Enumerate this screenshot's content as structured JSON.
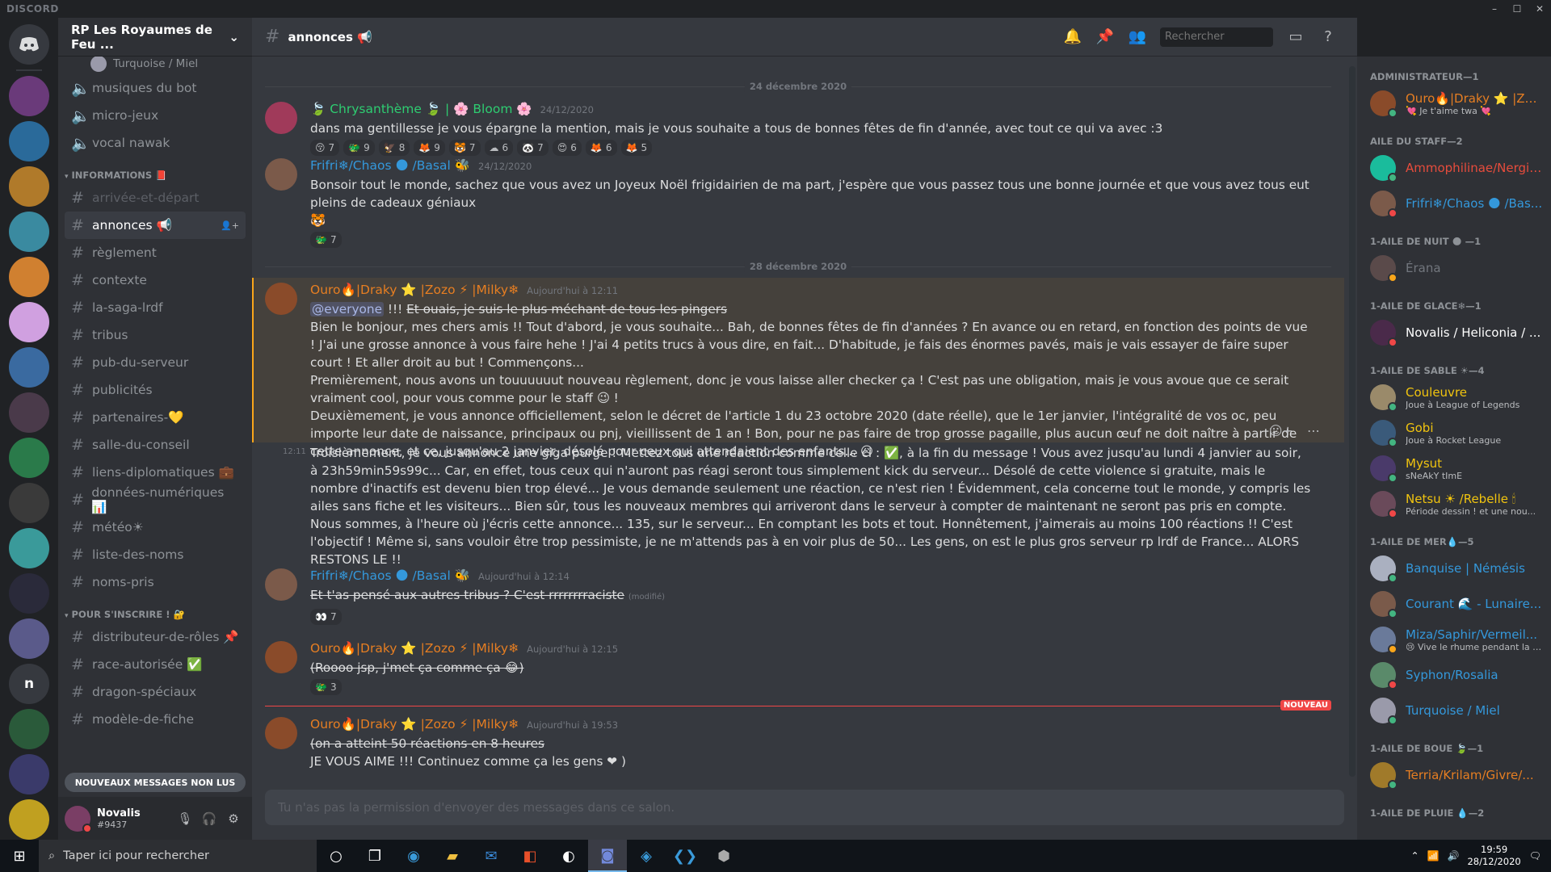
{
  "titlebar": {
    "brand": "DISCORD"
  },
  "guild": {
    "name": "RP Les Royaumes de Feu ..."
  },
  "channels": {
    "partial_top": "Turquoise / Miel",
    "voice": [
      "musiques du bot",
      "micro-jeux",
      "vocal nawak"
    ],
    "category_info": "INFORMATIONS 📕",
    "info_list": [
      {
        "name": "arrivée-et-départ",
        "faded": true
      },
      {
        "name": "annonces 📢",
        "selected": true
      },
      {
        "name": "règlement"
      },
      {
        "name": "contexte"
      },
      {
        "name": "la-saga-lrdf"
      },
      {
        "name": "tribus"
      },
      {
        "name": "pub-du-serveur"
      },
      {
        "name": "publicités"
      },
      {
        "name": "partenaires-💛"
      },
      {
        "name": "salle-du-conseil"
      },
      {
        "name": "liens-diplomatiques 💼"
      },
      {
        "name": "données-numériques 📊"
      },
      {
        "name": "météo☀"
      },
      {
        "name": "liste-des-noms"
      },
      {
        "name": "noms-pris"
      }
    ],
    "category_signup": "POUR S'INSCRIRE ! 🔐",
    "signup_list": [
      {
        "name": "distributeur-de-rôles 📌"
      },
      {
        "name": "race-autorisée ✅"
      },
      {
        "name": "dragon-spéciaux"
      },
      {
        "name": "modèle-de-fiche"
      }
    ],
    "new_messages_btn": "NOUVEAUX MESSAGES NON LUS"
  },
  "user": {
    "name": "Novalis",
    "tag": "#9437"
  },
  "chat": {
    "channel_title": "annonces 📢",
    "search_placeholder": "Rechercher",
    "date1": "24 décembre 2020",
    "date2": "28 décembre 2020",
    "composer": "Tu n'as pas la permission d'envoyer des messages dans ce salon.",
    "new_tag": "NOUVEAU",
    "m1": {
      "author": "🍃 Chrysanthème 🍃 | 🌸 Bloom 🌸",
      "time": "24/12/2020",
      "text": "dans ma gentillesse je vous épargne la mention, mais je vous souhaite a tous de bonnes fêtes de fin d'année, avec tout ce qui va avec :3",
      "reactions": [
        {
          "e": "😚",
          "n": "7"
        },
        {
          "e": "🐲",
          "n": "9"
        },
        {
          "e": "🦅",
          "n": "8"
        },
        {
          "e": "🦊",
          "n": "9"
        },
        {
          "e": "🐯",
          "n": "7"
        },
        {
          "e": "☁",
          "n": "6"
        },
        {
          "e": "🐼",
          "n": "7"
        },
        {
          "e": "😍",
          "n": "6"
        },
        {
          "e": "🦊",
          "n": "6"
        },
        {
          "e": "🦊",
          "n": "5"
        }
      ]
    },
    "m2": {
      "author": "Frifri❄/Chaos 🌑 /Basal 🐝",
      "time": "24/12/2020",
      "text": "Bonsoir tout le monde, sachez que vous avez un Joyeux Noël frigidairien de ma part, j'espère que vous passez tous une bonne journée et que vous avez tous eut pleins de cadeaux géniaux",
      "emoji": "🐯",
      "reactions": [
        {
          "e": "🐲",
          "n": "7"
        }
      ]
    },
    "m3": {
      "author": "Ouro🔥|Draky ⭐ |Zozo ⚡ |Milky❄",
      "time": "Aujourd'hui à 12:11",
      "mention": "@everyone",
      "bangs": "!!!",
      "strike": "Et ouais, je suis le plus méchant de tous les pingers",
      "p1": "Bien le bonjour, mes chers amis !! Tout d'abord, je vous souhaite... Bah, de bonnes fêtes de fin d'années ? En avance ou en retard, en fonction des points de vue ! J'ai une grosse annonce à vous faire hehe ! J'ai 4 petits trucs à vous dire, en fait... D'habitude, je fais des énormes pavés, mais je vais essayer de faire super court ! Et aller droit au but ! Commençons...",
      "p2": "Premièrement, nous avons un touuuuuut nouveau règlement, donc je vous laisse aller checker ça ! C'est pas une obligation, mais je vous avoue que ce serait vraiment cool, pour vous comme pour le staff 😉 !",
      "p3": "Deuxièmement, je vous annonce officiellement, selon le décret de l'article 1 du 23 octobre 2020 (date réelle), que le 1er janvier, l'intégralité de vos oc, peu importe leur date de naissance, principaux ou pnj, vieillissent de 1 an ! Bon, pour ne pas faire de trop grosse pagaille, plus aucun œuf ne doit naître à partir de cette annonce, et ce, jusqu'au 2 janvier, désolé pour ceux qui attendaient des enfants... 😥",
      "cont_time": "12:11",
      "p4": "Troisièmement, je vous annonce une giga purge ! Mettez tous une réaction comme celle ci : ✅, à la fin du message ! Vous avez jusqu'au lundi 4 janvier au soir, à 23h59min59s99c... Car, en effet, tous ceux qui n'auront pas réagi seront tous simplement kick du serveur... Désolé de cette violence si gratuite, mais le nombre d'inactifs est devenu bien trop élevé... Je vous demande seulement une réaction, ce n'est rien ! Évidemment, cela concerne tout le monde, y compris les ailes sans fiche et les visiteurs... Bien sûr, tous les nouveaux membres qui arriveront dans le serveur à compter de maintenant ne seront pas pris en compte. Nous sommes, à l'heure où j'écris cette annonce... 135, sur le serveur... En comptant les bots et tout. Honnêtement, j'aimerais au moins 100 réactions !! C'est l'objectif ! Même si, sans vouloir être trop pessimiste, je ne m'attends pas à en voir plus de 50... Les gens, on est le plus gros serveur rp lrdf de France... ALORS RESTONS LE !!"
    },
    "m4": {
      "author": "Frifri❄/Chaos 🌑 /Basal 🐝",
      "time": "Aujourd'hui à 12:14",
      "text": "Et t'as pensé aux autres tribus ? C'est rrrrrrrraciste",
      "edited": "(modifié)",
      "reactions": [
        {
          "e": "👀",
          "n": "7"
        }
      ]
    },
    "m5": {
      "author": "Ouro🔥|Draky ⭐ |Zozo ⚡ |Milky❄",
      "time": "Aujourd'hui à 12:15",
      "text": "(Roooo jsp, j'met ça comme ça 😂)",
      "reactions": [
        {
          "e": "🐲",
          "n": "3"
        }
      ]
    },
    "m6": {
      "author": "Ouro🔥|Draky ⭐ |Zozo ⚡ |Milky❄",
      "time": "Aujourd'hui à 19:53",
      "line1": "(on a atteint 50 réactions en 8 heures",
      "line2": "JE VOUS AIME !!! Continuez comme ça les gens ❤ )"
    }
  },
  "members": [
    {
      "cat": "ADMINISTRATEUR—1",
      "list": [
        {
          "name": "Ouro🔥|Draky ⭐ |Zoz...",
          "sub": "💘 Je t'aime twa 💘",
          "color": "#e67e22",
          "status": "#43b581",
          "av": "#8a4b2a"
        }
      ]
    },
    {
      "cat": "AILE DU STAFF—2",
      "list": [
        {
          "name": "Ammophilinae/Nergig...",
          "sub": "",
          "color": "#e74c3c",
          "status": "#43b581",
          "av": "#1abc9c"
        },
        {
          "name": "Frifri❄/Chaos 🌑 /Bas...",
          "sub": "",
          "color": "#3498db",
          "status": "#f04747",
          "av": "#7b5a4a"
        }
      ]
    },
    {
      "cat": "1-AILE DE NUIT 🌑 —1",
      "list": [
        {
          "name": "Érana",
          "sub": "",
          "color": "#72767d",
          "status": "#faa61a",
          "av": "#5a4a4a"
        }
      ]
    },
    {
      "cat": "1-AILE DE GLACE❄—1",
      "list": [
        {
          "name": "Novalis / Heliconia / ...",
          "sub": "",
          "color": "#ffffff",
          "status": "#f04747",
          "av": "#4a2a4a"
        }
      ]
    },
    {
      "cat": "1-AILE DE SABLE ☀—4",
      "list": [
        {
          "name": "Couleuvre",
          "sub": "Joue à League of Legends",
          "color": "#f1c40f",
          "status": "#43b581",
          "av": "#9a8a6a"
        },
        {
          "name": "Gobi",
          "sub": "Joue à Rocket League",
          "color": "#f1c40f",
          "status": "#43b581",
          "av": "#3a5a7a"
        },
        {
          "name": "Mysut",
          "sub": "sNeAkY tImE",
          "color": "#f1c40f",
          "status": "#43b581",
          "av": "#4a3a6a"
        },
        {
          "name": "Netsu ☀ /Rebelle 🕯",
          "sub": "Période dessin ! et une nou...",
          "color": "#f1c40f",
          "status": "#f04747",
          "av": "#6a4a5a"
        }
      ]
    },
    {
      "cat": "1-AILE DE MER💧—5",
      "list": [
        {
          "name": "Banquise | Némésis",
          "sub": "",
          "color": "#3498db",
          "status": "#43b581",
          "av": "#aab0c0"
        },
        {
          "name": "Courant 🌊 - Lunaire...",
          "sub": "",
          "color": "#3498db",
          "status": "#43b581",
          "av": "#7a5a4a"
        },
        {
          "name": "Miza/Saphir/Vermeil...",
          "sub": "😢 Vive le rhume pendant la p...",
          "color": "#3498db",
          "status": "#faa61a",
          "av": "#6a7a9a"
        },
        {
          "name": "Syphon/Rosalia",
          "sub": "",
          "color": "#3498db",
          "status": "#f04747",
          "av": "#5a8a6a"
        },
        {
          "name": "Turquoise / Miel",
          "sub": "",
          "color": "#3498db",
          "status": "#43b581",
          "av": "#9a9aaa"
        }
      ]
    },
    {
      "cat": "1-AILE DE BOUE 🍃—1",
      "list": [
        {
          "name": "Terria/Krilam/Givre/...",
          "sub": "",
          "color": "#e67e22",
          "status": "#43b581",
          "av": "#a07a2a"
        }
      ]
    },
    {
      "cat": "1-AILE DE PLUIE 💧—2",
      "list": []
    }
  ],
  "taskbar": {
    "search_placeholder": "Taper ici pour rechercher",
    "time": "19:59",
    "date": "28/12/2020"
  },
  "servers": [
    {
      "color": "#6a3a7a"
    },
    {
      "color": "#2a6a9a"
    },
    {
      "color": "#b07a2a"
    },
    {
      "color": "#3a8aa0"
    },
    {
      "color": "#d08030"
    },
    {
      "color": "#d0a0e0"
    },
    {
      "color": "#3a6aa0"
    },
    {
      "color": "#4a3a4a"
    },
    {
      "color": "#2a7a4a"
    },
    {
      "color": "#3a3a3a"
    },
    {
      "color": "#3a9a9a"
    },
    {
      "color": "#2a2a3a"
    },
    {
      "color": "#5a5a8a"
    },
    {
      "color": "#36393f",
      "letter": "n"
    },
    {
      "color": "#2a5a3a"
    },
    {
      "color": "#3a3a6a"
    },
    {
      "color": "#c0a020"
    }
  ]
}
